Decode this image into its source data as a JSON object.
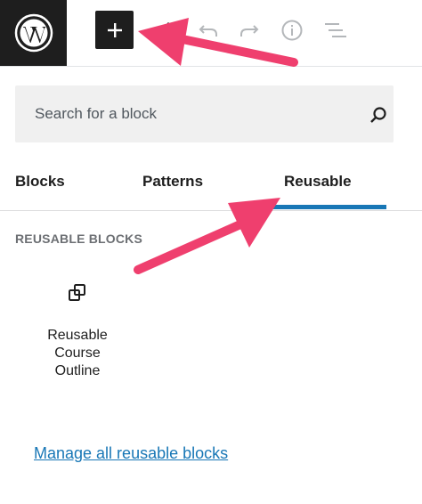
{
  "toolbar": {
    "logo": "wordpress-logo",
    "add_icon": "plus-icon",
    "tools": [
      "pencil-icon",
      "undo-icon",
      "redo-icon",
      "info-icon",
      "list-view-icon"
    ]
  },
  "inserter": {
    "search": {
      "placeholder": "Search for a block",
      "value": ""
    },
    "tabs": [
      {
        "label": "Blocks",
        "active": false
      },
      {
        "label": "Patterns",
        "active": false
      },
      {
        "label": "Reusable",
        "active": true
      }
    ],
    "section_title": "REUSABLE BLOCKS",
    "blocks": [
      {
        "label": "Reusable Course Outline",
        "icon": "reusable-block-icon"
      }
    ],
    "manage_link": "Manage all reusable blocks"
  },
  "colors": {
    "accent": "#1877b6",
    "annotation": "#ef3f6e",
    "dark": "#1e1e1e"
  }
}
